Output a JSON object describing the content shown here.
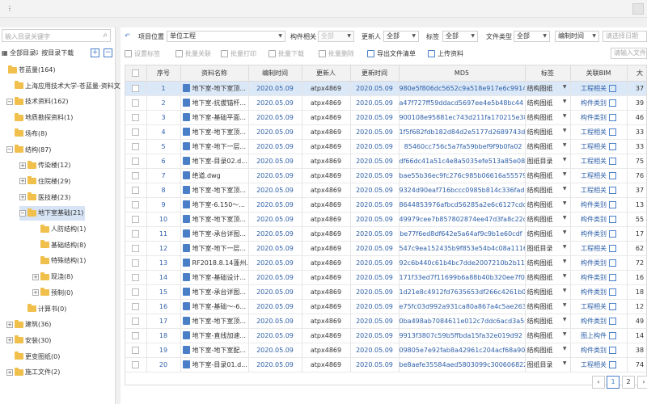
{
  "window": {
    "grip": "⋮",
    "close_label": ""
  },
  "left": {
    "search_placeholder": "输入目录关键字",
    "all_dirs": "全部目录",
    "download_by_dir": "按目录下载",
    "expand": "+",
    "collapse": "−"
  },
  "tree": [
    {
      "label": "苍蓝量(164)",
      "level": 0,
      "toggle": "",
      "folder": true
    },
    {
      "label": "上海应用技术大学-苍蓝量-资料文件(1",
      "level": 1,
      "toggle": "",
      "folder": true
    },
    {
      "label": "技术资料(162)",
      "level": 1,
      "toggle": "−",
      "folder": true
    },
    {
      "label": "地质勘探资料(1)",
      "level": 2,
      "toggle": "",
      "folder": true
    },
    {
      "label": "场布(8)",
      "level": 2,
      "toggle": "",
      "folder": true
    },
    {
      "label": "结构(87)",
      "level": 2,
      "toggle": "−",
      "folder": true
    },
    {
      "label": "传染楼(12)",
      "level": 3,
      "toggle": "+",
      "folder": true
    },
    {
      "label": "住院楼(29)",
      "level": 3,
      "toggle": "+",
      "folder": true
    },
    {
      "label": "医技楼(23)",
      "level": 3,
      "toggle": "+",
      "folder": true
    },
    {
      "label": "地下室基础(21)",
      "level": 3,
      "toggle": "−",
      "folder": true,
      "selected": true
    },
    {
      "label": "人防结构(1)",
      "level": 4,
      "toggle": "",
      "folder": true
    },
    {
      "label": "基础结构(8)",
      "level": 4,
      "toggle": "",
      "folder": true
    },
    {
      "label": "特殊结构(1)",
      "level": 4,
      "toggle": "",
      "folder": true
    },
    {
      "label": "现浇(8)",
      "level": 4,
      "toggle": "+",
      "folder": true
    },
    {
      "label": "预制(0)",
      "level": 4,
      "toggle": "+",
      "folder": true
    },
    {
      "label": "计算书(0)",
      "level": 3,
      "toggle": "",
      "folder": true
    },
    {
      "label": "建筑(36)",
      "level": 2,
      "toggle": "+",
      "folder": true
    },
    {
      "label": "安装(30)",
      "level": 2,
      "toggle": "+",
      "folder": true
    },
    {
      "label": "更变图纸(0)",
      "level": 2,
      "toggle": "",
      "folder": true
    },
    {
      "label": "施工文件(2)",
      "level": 1,
      "toggle": "+",
      "folder": true
    }
  ],
  "filters": {
    "location_label": "项目位置",
    "location_value": "单位工程",
    "component_label": "构件相关",
    "component_value": "全部",
    "updater_label": "更新人",
    "updater_value": "全部",
    "tag_label": "标签",
    "tag_value": "全部",
    "filetype_label": "文件类型",
    "filetype_value": "全部",
    "time_value": "编制时间",
    "date_placeholder": "请选择日期"
  },
  "toolbar": {
    "set_tag": "设置标签",
    "batch_associate": "批量关联",
    "batch_print": "批量打印",
    "batch_download": "批量下载",
    "batch_delete": "批量删除",
    "export_list": "导出文件清单",
    "upload": "上传资料",
    "right_input": "请输入文件"
  },
  "table": {
    "headers": [
      "",
      "序号",
      "资料名称",
      "编制时间",
      "更新人",
      "更新时间",
      "MD5",
      "标签",
      "关联BIM",
      "大"
    ],
    "rows": [
      {
        "no": "1",
        "name": "地下室-地下室顶...",
        "date": "2020.05.09",
        "user": "atpx4869",
        "udate": "2020.05.09",
        "md5": "980e5f806dc5652c9a518e917e6c9914",
        "tag": "结构图纸",
        "bim": "工程相关",
        "size": "37"
      },
      {
        "no": "2",
        "name": "地下室-抗拔锚杆...",
        "date": "2020.05.09",
        "user": "atpx4869",
        "udate": "2020.05.09",
        "md5": "a47f727ff59ddacd5697ee4e5b48bc44",
        "tag": "结构图纸",
        "bim": "构件类别",
        "size": "39"
      },
      {
        "no": "3",
        "name": "地下室-基础平面...",
        "date": "2020.05.09",
        "user": "atpx4869",
        "udate": "2020.05.09",
        "md5": "900108e95881ec743d211fa170215e38",
        "tag": "结构图纸",
        "bim": "构件类别",
        "size": "46"
      },
      {
        "no": "4",
        "name": "地下室-地下室顶...",
        "date": "2020.05.09",
        "user": "atpx4869",
        "udate": "2020.05.09",
        "md5": "1f5f682fdb182d84d2e5177d2689743d",
        "tag": "结构图纸",
        "bim": "工程相关",
        "size": "33"
      },
      {
        "no": "5",
        "name": "地下室-地下一层...",
        "date": "2020.05.09",
        "user": "atpx4869",
        "udate": "2020.05.09",
        "md5": "85460cc756c5a7fa59bbef9f9b0fa02",
        "tag": "结构图纸",
        "bim": "工程相关",
        "size": "33"
      },
      {
        "no": "6",
        "name": "地下室-目录02.d...",
        "date": "2020.05.09",
        "user": "atpx4869",
        "udate": "2020.05.09",
        "md5": "df66dc41a51c4e8a5035efe513a85e08",
        "tag": "图纸目录",
        "bim": "工程相关",
        "size": "75"
      },
      {
        "no": "7",
        "name": "绝道.dwg",
        "date": "2020.05.09",
        "user": "atpx4869",
        "udate": "2020.05.09",
        "md5": "bae55b36ec9fc276c985b06616a55579",
        "tag": "结构图纸",
        "bim": "工程相关",
        "size": "76"
      },
      {
        "no": "8",
        "name": "地下室-地下室顶...",
        "date": "2020.05.09",
        "user": "atpx4869",
        "udate": "2020.05.09",
        "md5": "9324d90eaf716bccc0985b814c336fad",
        "tag": "结构图纸",
        "bim": "工程相关",
        "size": "37"
      },
      {
        "no": "9",
        "name": "地下室-6.150～...",
        "date": "2020.05.09",
        "user": "atpx4869",
        "udate": "2020.05.09",
        "md5": "8644853976afbcd56285a2e6c6127cdc",
        "tag": "结构图纸",
        "bim": "构件类别",
        "size": "13"
      },
      {
        "no": "10",
        "name": "地下室-地下室顶...",
        "date": "2020.05.09",
        "user": "atpx4869",
        "udate": "2020.05.09",
        "md5": "49979cee7b857802874ee47d3fa8c22d",
        "tag": "结构图纸",
        "bim": "构件类别",
        "size": "55"
      },
      {
        "no": "11",
        "name": "地下室-承台详图...",
        "date": "2020.05.09",
        "user": "atpx4869",
        "udate": "2020.05.09",
        "md5": "be77f6ed8df642e5a64af9c9b1e60cdf",
        "tag": "结构图纸",
        "bim": "构件类别",
        "size": "17"
      },
      {
        "no": "12",
        "name": "地下室-地下一层...",
        "date": "2020.05.09",
        "user": "atpx4869",
        "udate": "2020.05.09",
        "md5": "547c9ea152435b9f853e54b4c08a1116",
        "tag": "图纸目录",
        "bim": "工程相关",
        "size": "62"
      },
      {
        "no": "13",
        "name": "RF2018.8.14蓬州...",
        "date": "2020.05.09",
        "user": "atpx4869",
        "udate": "2020.05.09",
        "md5": "92c6b440c61b4bc7dde2007210b2b111",
        "tag": "结构图纸",
        "bim": "构件类别",
        "size": "72"
      },
      {
        "no": "14",
        "name": "地下室-基础设计...",
        "date": "2020.05.09",
        "user": "atpx4869",
        "udate": "2020.05.09",
        "md5": "171f33ed7f11699b6a88b40b320ee7f0",
        "tag": "结构图纸",
        "bim": "构件类别",
        "size": "16"
      },
      {
        "no": "15",
        "name": "地下室-承台详图...",
        "date": "2020.05.09",
        "user": "atpx4869",
        "udate": "2020.05.09",
        "md5": "1d21e8c4912fd7635653df266c4261b0",
        "tag": "结构图纸",
        "bim": "构件类别",
        "size": "18"
      },
      {
        "no": "16",
        "name": "地下室-基础～-6...",
        "date": "2020.05.09",
        "user": "atpx4869",
        "udate": "2020.05.09",
        "md5": "e75fc03d992a931ca80a867a4c5ae263",
        "tag": "结构图纸",
        "bim": "工程相关",
        "size": "12"
      },
      {
        "no": "17",
        "name": "地下室-地下室顶...",
        "date": "2020.05.09",
        "user": "atpx4869",
        "udate": "2020.05.09",
        "md5": "0ba498ab7084611e012c7ddc6acd3a56",
        "tag": "结构图纸",
        "bim": "构件类别",
        "size": "49"
      },
      {
        "no": "18",
        "name": "地下室-直线加速...",
        "date": "2020.05.09",
        "user": "atpx4869",
        "udate": "2020.05.09",
        "md5": "9913f3807c59b5ffbda15fa32e019d92",
        "tag": "结构图纸",
        "bim": "图上构件",
        "size": "14"
      },
      {
        "no": "19",
        "name": "地下室-地下室配...",
        "date": "2020.05.09",
        "user": "atpx4869",
        "udate": "2020.05.09",
        "md5": "09805e7e92fab8a42961c204acf68a90",
        "tag": "结构图纸",
        "bim": "构件类别",
        "size": "38"
      },
      {
        "no": "20",
        "name": "地下室-目录01.d...",
        "date": "2020.05.09",
        "user": "atpx4869",
        "udate": "2020.05.09",
        "md5": "be8aefe35584aed5803099c300606822",
        "tag": "图纸目录",
        "bim": "工程相关",
        "size": "74"
      }
    ]
  },
  "pager": {
    "prev": "‹",
    "page1": "1",
    "page2": "2",
    "next": "›"
  },
  "colors": {
    "accent": "#4a7fc8",
    "selected_row": "#dbe8f7",
    "folder": "#f0bf4c",
    "link": "#2d5fa8"
  }
}
